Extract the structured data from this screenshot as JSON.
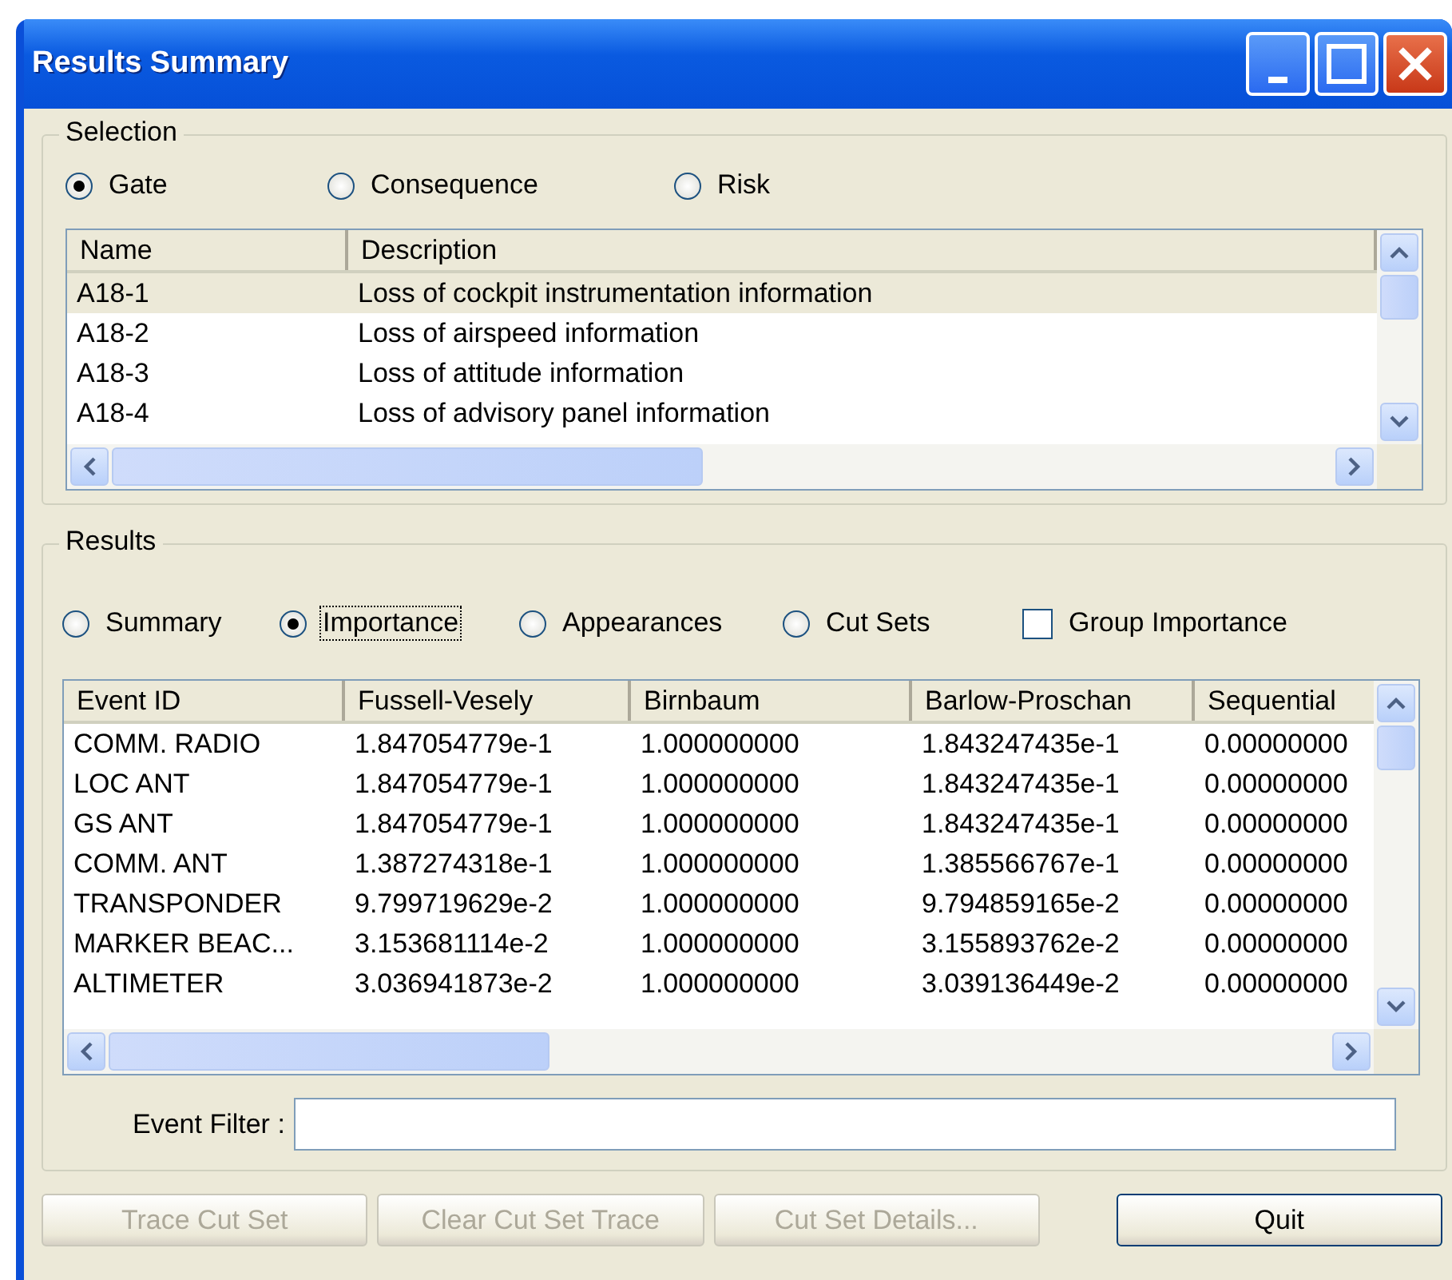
{
  "window": {
    "title": "Results Summary"
  },
  "selection": {
    "legend": "Selection",
    "options": [
      {
        "label": "Gate",
        "selected": true
      },
      {
        "label": "Consequence",
        "selected": false
      },
      {
        "label": "Risk",
        "selected": false
      }
    ],
    "table": {
      "columns": [
        "Name",
        "Description"
      ],
      "rows": [
        {
          "cells": [
            "A18-1",
            "Loss of cockpit instrumentation information"
          ],
          "selected": true
        },
        {
          "cells": [
            "A18-2",
            "Loss of airspeed information"
          ],
          "selected": false
        },
        {
          "cells": [
            "A18-3",
            "Loss of attitude information"
          ],
          "selected": false
        },
        {
          "cells": [
            "A18-4",
            "Loss of advisory panel information"
          ],
          "selected": false
        }
      ]
    }
  },
  "results": {
    "legend": "Results",
    "options": [
      {
        "label": "Summary",
        "selected": false,
        "focused": false
      },
      {
        "label": "Importance",
        "selected": true,
        "focused": true
      },
      {
        "label": "Appearances",
        "selected": false,
        "focused": false
      },
      {
        "label": "Cut Sets",
        "selected": false,
        "focused": false
      }
    ],
    "group_importance": {
      "label": "Group Importance",
      "checked": false
    },
    "table": {
      "columns": [
        "Event ID",
        "Fussell-Vesely",
        "Birnbaum",
        "Barlow-Proschan",
        "Sequential"
      ],
      "rows": [
        {
          "cells": [
            "COMM. RADIO",
            "1.847054779e-1",
            "1.000000000",
            "1.843247435e-1",
            "0.00000000"
          ]
        },
        {
          "cells": [
            "LOC ANT",
            "1.847054779e-1",
            "1.000000000",
            "1.843247435e-1",
            "0.00000000"
          ]
        },
        {
          "cells": [
            "GS ANT",
            "1.847054779e-1",
            "1.000000000",
            "1.843247435e-1",
            "0.00000000"
          ]
        },
        {
          "cells": [
            "COMM. ANT",
            "1.387274318e-1",
            "1.000000000",
            "1.385566767e-1",
            "0.00000000"
          ]
        },
        {
          "cells": [
            "TRANSPONDER",
            "9.799719629e-2",
            "1.000000000",
            "9.794859165e-2",
            "0.00000000"
          ]
        },
        {
          "cells": [
            "MARKER BEAC...",
            "3.153681114e-2",
            "1.000000000",
            "3.155893762e-2",
            "0.00000000"
          ]
        },
        {
          "cells": [
            "ALTIMETER",
            "3.036941873e-2",
            "1.000000000",
            "3.039136449e-2",
            "0.00000000"
          ]
        }
      ]
    },
    "event_filter": {
      "label": "Event Filter :"
    }
  },
  "buttons": [
    {
      "label": "Trace Cut Set",
      "disabled": true
    },
    {
      "label": "Clear Cut Set Trace",
      "disabled": true
    },
    {
      "label": "Cut Set Details...",
      "disabled": true
    },
    {
      "label": "Quit",
      "disabled": false
    }
  ]
}
